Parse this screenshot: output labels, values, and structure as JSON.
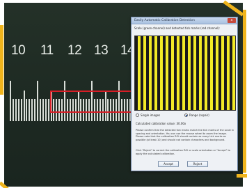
{
  "ruler": {
    "numbers": [
      "10",
      "11",
      "12",
      "13",
      "14"
    ]
  },
  "dialog": {
    "title": "Easily Automatic Calibration Detection",
    "subtitle": "Scale (green channel) and detected tick marks (red channel):",
    "radio_single": "Single images",
    "radio_range": "Range (repair)",
    "calibration_label": "Calculated calibration value: 30.00x",
    "paragraph1": "Please confirm that the detected tick marks match the tick marks of the scale in spacing and orientation. You can use the mouse wheel to zoom the image. Please note that the calibration ROI should contain as many tick marks as possible (at least 10) and should not contain characters and background.",
    "paragraph2": "Click \"Reject\" to correct the calibration ROI or scale orientation or \"Accept\" to apply the calculated calibration.",
    "accept_label": "Accept",
    "reject_label": "Reject",
    "close_label": "x"
  },
  "colors": {
    "frame_accent": "#f0b41c",
    "roi_box": "#d61e26",
    "scan_stripe": "#f2ea27"
  }
}
